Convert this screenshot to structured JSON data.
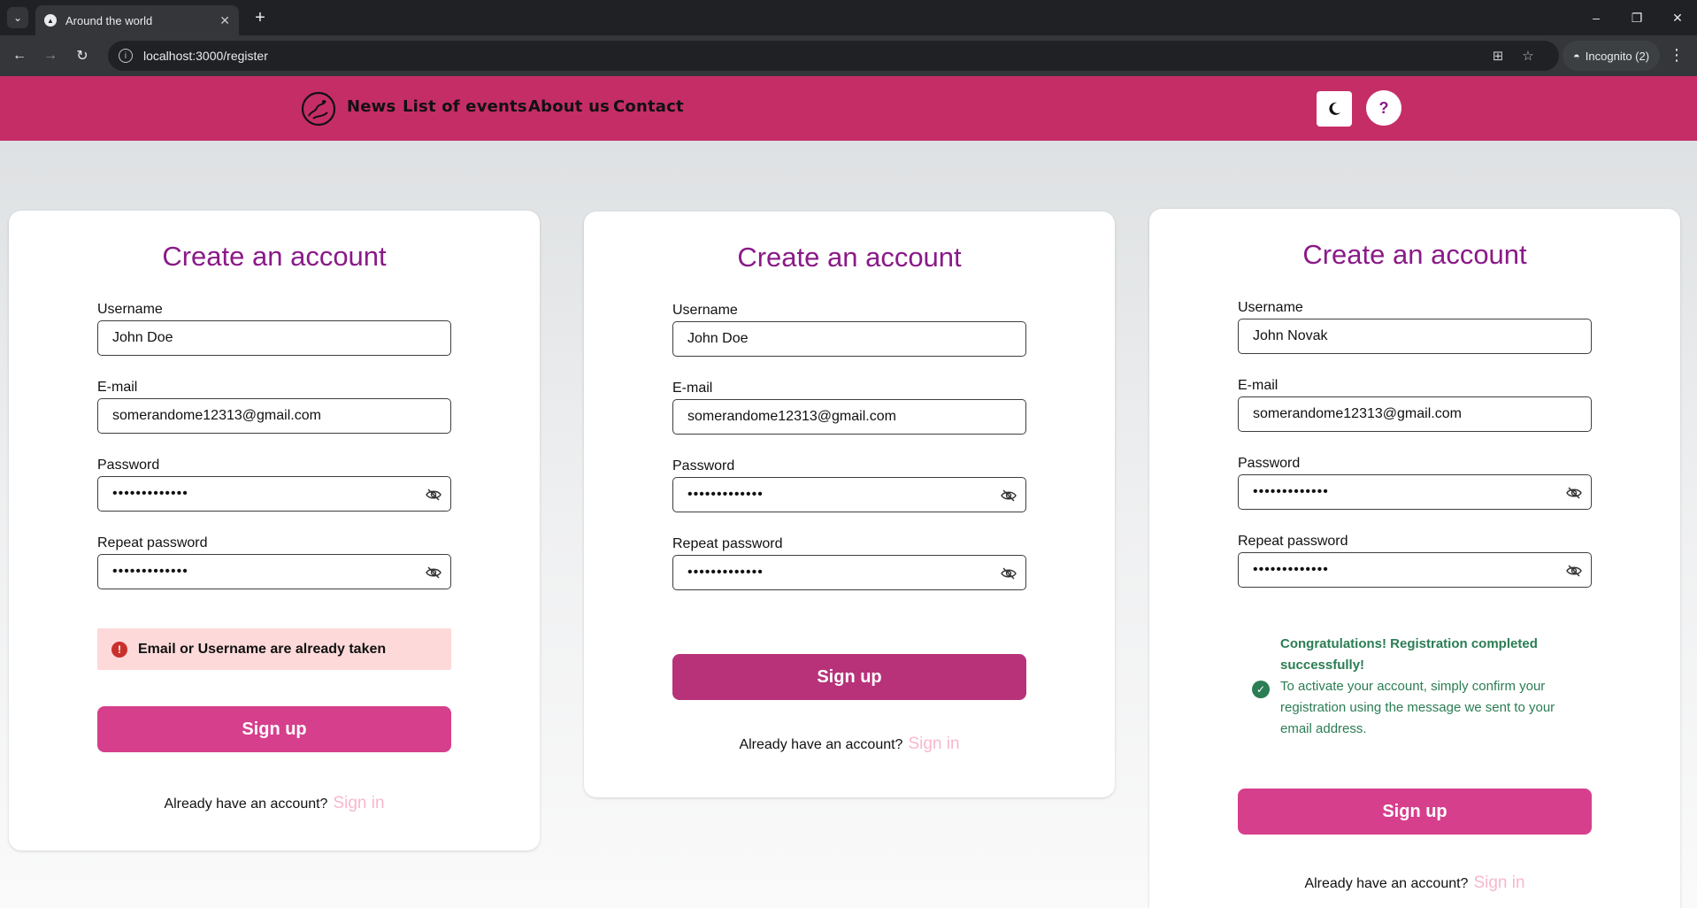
{
  "browser": {
    "tab_title": "Around the world",
    "url": "localhost:3000/register",
    "incognito_label": "Incognito (2)"
  },
  "nav": {
    "links": [
      "News",
      "List of events",
      "About us",
      "Contact"
    ],
    "help_label": "?"
  },
  "cards": [
    {
      "title": "Create an account",
      "username_label": "Username",
      "username_value": "John Doe",
      "email_label": "E-mail",
      "email_value": "somerandome12313@gmail.com",
      "password_label": "Password",
      "password_value": "•••••••••••••",
      "repeat_label": "Repeat password",
      "repeat_value": "•••••••••••••",
      "error_text": "Email or Username are already taken",
      "signup_label": "Sign up",
      "already_text": "Already have an account?",
      "signin_label": "Sign in"
    },
    {
      "title": "Create an account",
      "username_label": "Username",
      "username_value": "John Doe",
      "email_label": "E-mail",
      "email_value": "somerandome12313@gmail.com",
      "password_label": "Password",
      "password_value": "•••••••••••••",
      "repeat_label": "Repeat password",
      "repeat_value": "•••••••••••••",
      "signup_label": "Sign up",
      "already_text": "Already have an account?",
      "signin_label": "Sign in"
    },
    {
      "title": "Create an account",
      "username_label": "Username",
      "username_value": "John Novak",
      "email_label": "E-mail",
      "email_value": "somerandome12313@gmail.com",
      "password_label": "Password",
      "password_value": "•••••••••••••",
      "repeat_label": "Repeat password",
      "repeat_value": "•••••••••••••",
      "success_title_1": "Congratulations! Registration completed",
      "success_title_2": "successfully!",
      "success_msg_1": "To activate your account, simply confirm your",
      "success_msg_2": "registration using the message we sent to your",
      "success_msg_3": "email address.",
      "signup_label": "Sign up",
      "already_text": "Already have an account?",
      "signin_label": "Sign in"
    }
  ],
  "colors": {
    "header": "#c52d67",
    "title": "#8a1a88",
    "button": "#d63f8c",
    "success": "#2b7d53",
    "error_bg": "#fdd9d9"
  }
}
